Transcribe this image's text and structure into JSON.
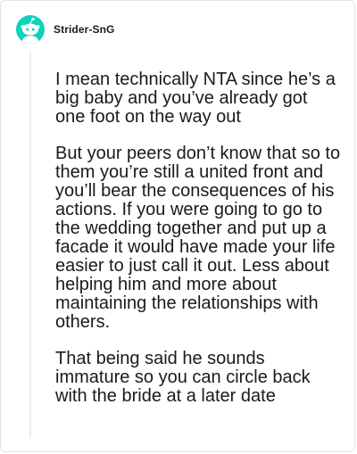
{
  "comment": {
    "author": "Strider-SnG",
    "avatar_icon": "snoo-avatar-icon",
    "avatar_color": "#0dd3bb",
    "paragraphs": [
      "I mean technically NTA since he’s a big baby and you’ve already got one foot on the way out",
      "But your peers don’t know that so to them you’re still a united front and you’ll bear the consequences of his actions. If you were going to go to the wedding together and put up a facade it would have made your life easier to just call it out. Less about helping him and more about maintaining the relationships with others.",
      "That being said he sounds immature so you can circle back with the bride at a later date"
    ]
  }
}
